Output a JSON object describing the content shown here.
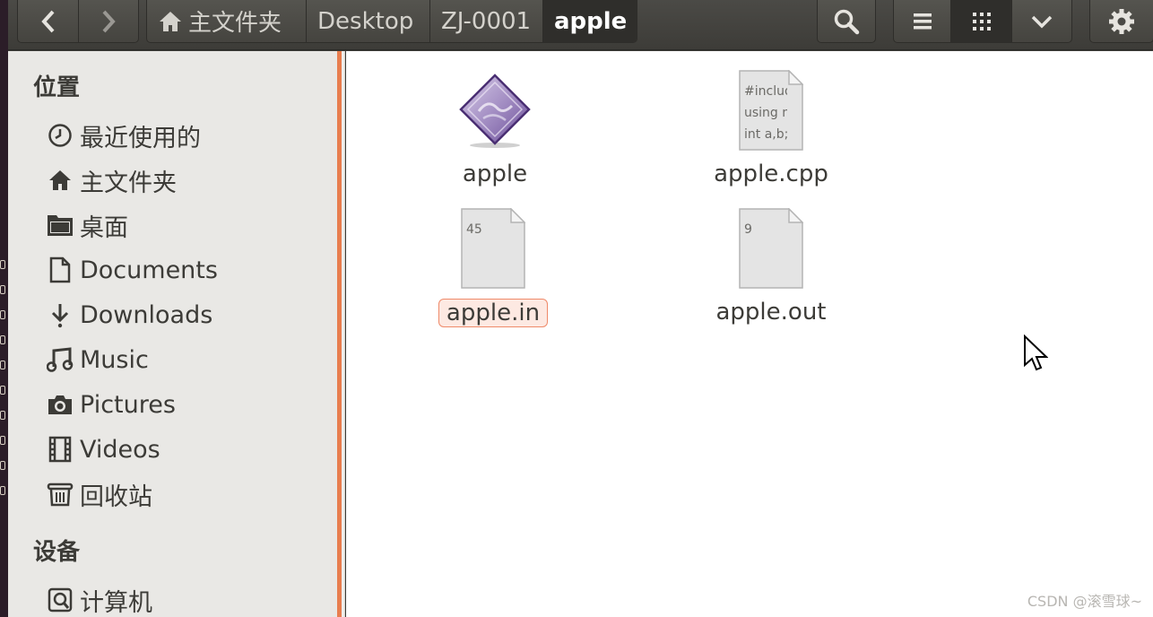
{
  "toolbar": {
    "breadcrumbs": [
      {
        "label": "主文件夹",
        "icon": "home-icon"
      },
      {
        "label": "Desktop"
      },
      {
        "label": "ZJ-0001"
      },
      {
        "label": "apple",
        "current": true
      }
    ],
    "nav_icons": [
      "back-icon",
      "forward-icon"
    ],
    "right_icons": [
      "search-icon",
      "list-view-icon",
      "grid-view-icon",
      "chevron-down-icon",
      "gear-icon"
    ]
  },
  "sidebar": {
    "places_heading": "位置",
    "items": [
      {
        "label": "最近使用的",
        "icon": "clock-icon"
      },
      {
        "label": "主文件夹",
        "icon": "home-icon"
      },
      {
        "label": "桌面",
        "icon": "folder-icon"
      },
      {
        "label": "Documents",
        "icon": "document-icon"
      },
      {
        "label": "Downloads",
        "icon": "download-icon"
      },
      {
        "label": "Music",
        "icon": "music-icon"
      },
      {
        "label": "Pictures",
        "icon": "camera-icon"
      },
      {
        "label": "Videos",
        "icon": "film-icon"
      },
      {
        "label": "回收站",
        "icon": "trash-icon"
      }
    ],
    "devices_heading": "设备",
    "devices": [
      {
        "label": "计算机",
        "icon": "computer-icon"
      }
    ]
  },
  "files": [
    {
      "name": "apple",
      "type": "executable",
      "icon": "executable-icon"
    },
    {
      "name": "apple.cpp",
      "type": "text",
      "preview": "#include\nusing n\nint a,b;"
    },
    {
      "name": "apple.in",
      "type": "text",
      "preview": "45",
      "renaming": true
    },
    {
      "name": "apple.out",
      "type": "text",
      "preview": "9"
    }
  ],
  "watermark": "CSDN @滚雪球~",
  "colors": {
    "accent": "#e87d4e",
    "toolbar": "#3c3b37",
    "sidebar": "#e9e8e5",
    "rename_bg": "#fde9e2"
  }
}
